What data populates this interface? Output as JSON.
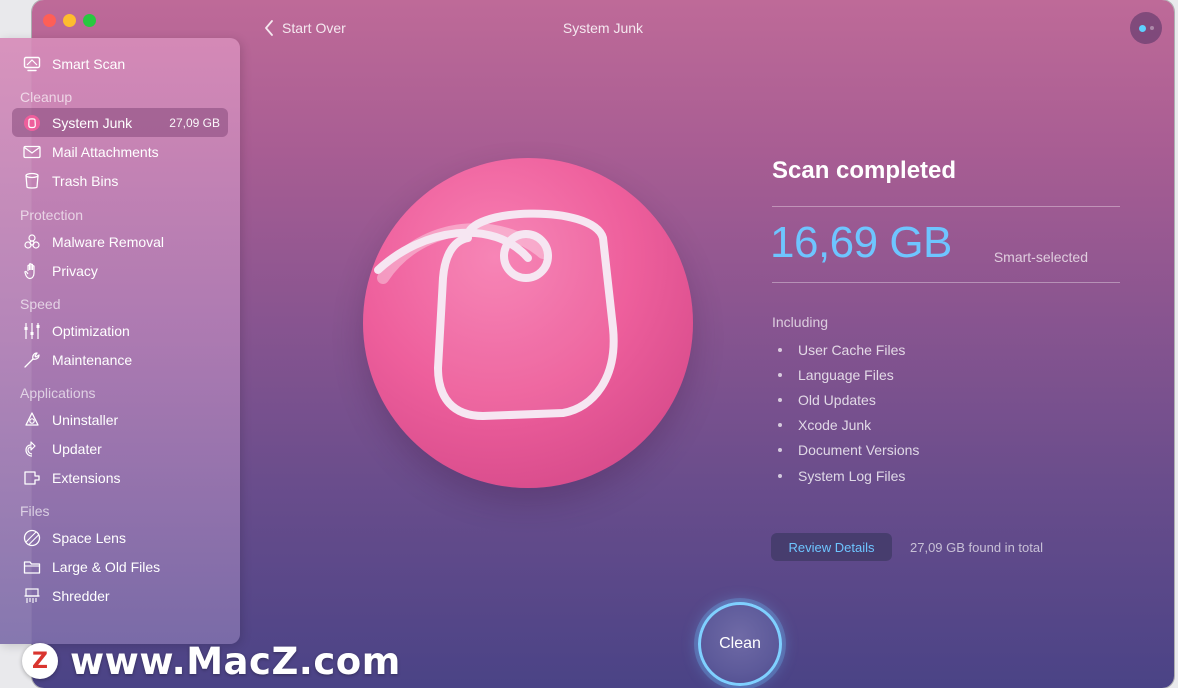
{
  "window": {
    "title": "System Junk",
    "back_label": "Start Over"
  },
  "sidebar": {
    "top_item": {
      "label": "Smart Scan",
      "icon": "monitor-icon"
    },
    "sections": [
      {
        "title": "Cleanup",
        "items": [
          {
            "label": "System Junk",
            "badge": "27,09 GB",
            "icon": "system-junk-icon",
            "active": true
          },
          {
            "label": "Mail Attachments",
            "icon": "envelope-icon"
          },
          {
            "label": "Trash Bins",
            "icon": "trash-icon"
          }
        ]
      },
      {
        "title": "Protection",
        "items": [
          {
            "label": "Malware Removal",
            "icon": "biohazard-icon"
          },
          {
            "label": "Privacy",
            "icon": "hand-icon"
          }
        ]
      },
      {
        "title": "Speed",
        "items": [
          {
            "label": "Optimization",
            "icon": "sliders-icon"
          },
          {
            "label": "Maintenance",
            "icon": "wrench-icon"
          }
        ]
      },
      {
        "title": "Applications",
        "items": [
          {
            "label": "Uninstaller",
            "icon": "uninstaller-icon"
          },
          {
            "label": "Updater",
            "icon": "updater-icon"
          },
          {
            "label": "Extensions",
            "icon": "extensions-icon"
          }
        ]
      },
      {
        "title": "Files",
        "items": [
          {
            "label": "Space Lens",
            "icon": "space-lens-icon"
          },
          {
            "label": "Large & Old Files",
            "icon": "folder-icon"
          },
          {
            "label": "Shredder",
            "icon": "shredder-icon"
          }
        ]
      }
    ]
  },
  "main": {
    "heading": "Scan completed",
    "size": "16,69 GB",
    "smart_selected": "Smart-selected",
    "including_label": "Including",
    "including": [
      "User Cache Files",
      "Language Files",
      "Old Updates",
      "Xcode Junk",
      "Document Versions",
      "System Log Files"
    ],
    "review_button": "Review Details",
    "found_total": "27,09 GB found in total",
    "clean_button": "Clean"
  },
  "watermark": {
    "logo_letter": "Z",
    "text": "www.MacZ.com"
  },
  "colors": {
    "accent_blue": "#6ec5ff",
    "hero_pink": "#ee5f9c"
  }
}
